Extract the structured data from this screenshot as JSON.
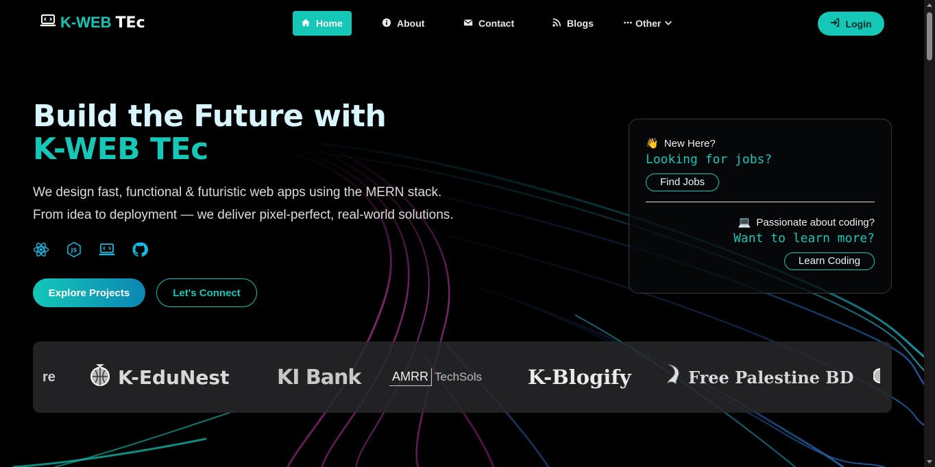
{
  "brand": {
    "part1": "K-WEB",
    "part2": "TEc"
  },
  "nav": {
    "items": [
      {
        "label": "Home",
        "icon": "home-icon"
      },
      {
        "label": "About",
        "icon": "info-icon"
      },
      {
        "label": "Contact",
        "icon": "envelope-icon"
      },
      {
        "label": "Blogs",
        "icon": "rss-icon"
      },
      {
        "label": "Other",
        "icon": "ellipsis-icon"
      }
    ],
    "login_label": "Login"
  },
  "hero": {
    "title_line1": "Build the Future with",
    "title_line2": "K-WEB TEc",
    "desc_line1": "We design fast, functional & futuristic web apps using the MERN stack.",
    "desc_line2": "From idea to deployment — we deliver pixel-perfect, real-world solutions.",
    "tech_icons": [
      "react-icon",
      "nodejs-icon",
      "laptop-code-icon",
      "github-icon"
    ],
    "primary_button": "Explore Projects",
    "secondary_button": "Let's Connect"
  },
  "card": {
    "q1": "New Here?",
    "q1_emoji": "👋",
    "q1_mono": "Looking for jobs?",
    "q1_button": "Find Jobs",
    "q2": "Passionate about coding?",
    "q2_emoji": "💻",
    "q2_mono": "Want to learn more?",
    "q2_button": "Learn Coding"
  },
  "logos": {
    "items": [
      "re",
      "K-EduNest",
      "KI Bank",
      "AMRR",
      "TechSols",
      "K-Blogify",
      "Free Palestine BD"
    ]
  },
  "colors": {
    "accent": "#14c7b7",
    "accent_dark": "#0c86b4",
    "background": "#000000"
  }
}
